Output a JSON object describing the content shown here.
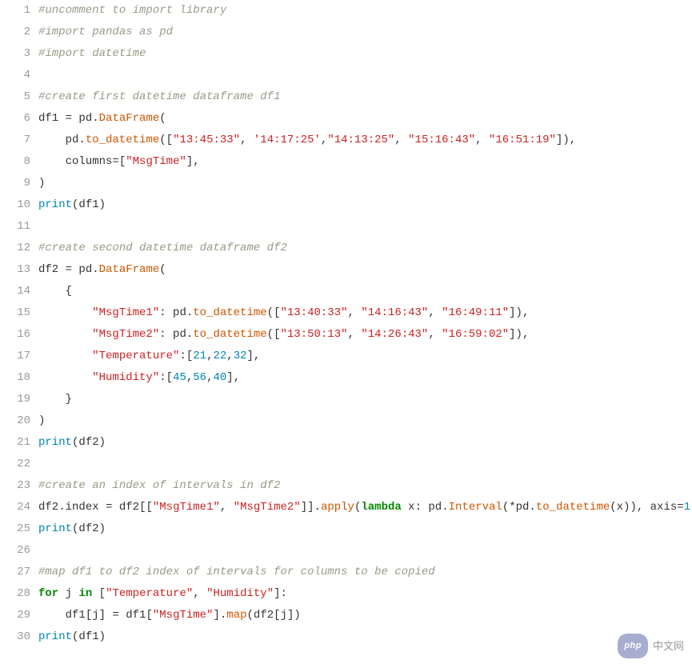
{
  "watermark": {
    "badge": "php",
    "text": "中文网"
  },
  "lines": [
    {
      "n": 1,
      "tokens": [
        [
          "c",
          "#uncomment to import library"
        ]
      ]
    },
    {
      "n": 2,
      "tokens": [
        [
          "c",
          "#import pandas as pd"
        ]
      ]
    },
    {
      "n": 3,
      "tokens": [
        [
          "c",
          "#import datetime"
        ]
      ]
    },
    {
      "n": 4,
      "tokens": []
    },
    {
      "n": 5,
      "tokens": [
        [
          "c",
          "#create first datetime dataframe df1"
        ]
      ]
    },
    {
      "n": 6,
      "tokens": [
        [
          "n",
          "df1 "
        ],
        [
          "o",
          "="
        ],
        [
          "n",
          " pd"
        ],
        [
          "p",
          "."
        ],
        [
          "nf",
          "DataFrame"
        ],
        [
          "p",
          "("
        ]
      ]
    },
    {
      "n": 7,
      "tokens": [
        [
          "n",
          "    pd"
        ],
        [
          "p",
          "."
        ],
        [
          "nf",
          "to_datetime"
        ],
        [
          "p",
          "(["
        ],
        [
          "s",
          "\"13:45:33\""
        ],
        [
          "p",
          ", "
        ],
        [
          "s",
          "'14:17:25'"
        ],
        [
          "p",
          ","
        ],
        [
          "s",
          "\"14:13:25\""
        ],
        [
          "p",
          ", "
        ],
        [
          "s",
          "\"15:16:43\""
        ],
        [
          "p",
          ", "
        ],
        [
          "s",
          "\"16:51:19\""
        ],
        [
          "p",
          "]),"
        ]
      ]
    },
    {
      "n": 8,
      "tokens": [
        [
          "n",
          "    columns"
        ],
        [
          "o",
          "="
        ],
        [
          "p",
          "["
        ],
        [
          "s",
          "\"MsgTime\""
        ],
        [
          "p",
          "],"
        ]
      ]
    },
    {
      "n": 9,
      "tokens": [
        [
          "p",
          ")"
        ]
      ]
    },
    {
      "n": 10,
      "tokens": [
        [
          "nn",
          "print"
        ],
        [
          "p",
          "("
        ],
        [
          "n",
          "df1"
        ],
        [
          "p",
          ")"
        ]
      ]
    },
    {
      "n": 11,
      "tokens": []
    },
    {
      "n": 12,
      "tokens": [
        [
          "c",
          "#create second datetime dataframe df2"
        ]
      ]
    },
    {
      "n": 13,
      "tokens": [
        [
          "n",
          "df2 "
        ],
        [
          "o",
          "="
        ],
        [
          "n",
          " pd"
        ],
        [
          "p",
          "."
        ],
        [
          "nf",
          "DataFrame"
        ],
        [
          "p",
          "("
        ]
      ]
    },
    {
      "n": 14,
      "tokens": [
        [
          "p",
          "    {"
        ]
      ]
    },
    {
      "n": 15,
      "tokens": [
        [
          "n",
          "        "
        ],
        [
          "s",
          "\"MsgTime1\""
        ],
        [
          "p",
          ": pd."
        ],
        [
          "nf",
          "to_datetime"
        ],
        [
          "p",
          "(["
        ],
        [
          "s",
          "\"13:40:33\""
        ],
        [
          "p",
          ", "
        ],
        [
          "s",
          "\"14:16:43\""
        ],
        [
          "p",
          ", "
        ],
        [
          "s",
          "\"16:49:11\""
        ],
        [
          "p",
          "]),"
        ]
      ]
    },
    {
      "n": 16,
      "tokens": [
        [
          "n",
          "        "
        ],
        [
          "s",
          "\"MsgTime2\""
        ],
        [
          "p",
          ": pd."
        ],
        [
          "nf",
          "to_datetime"
        ],
        [
          "p",
          "(["
        ],
        [
          "s",
          "\"13:50:13\""
        ],
        [
          "p",
          ", "
        ],
        [
          "s",
          "\"14:26:43\""
        ],
        [
          "p",
          ", "
        ],
        [
          "s",
          "\"16:59:02\""
        ],
        [
          "p",
          "]),"
        ]
      ]
    },
    {
      "n": 17,
      "tokens": [
        [
          "n",
          "        "
        ],
        [
          "s",
          "\"Temperature\""
        ],
        [
          "p",
          ":["
        ],
        [
          "mi",
          "21"
        ],
        [
          "p",
          ","
        ],
        [
          "mi",
          "22"
        ],
        [
          "p",
          ","
        ],
        [
          "mi",
          "32"
        ],
        [
          "p",
          "],"
        ]
      ]
    },
    {
      "n": 18,
      "tokens": [
        [
          "n",
          "        "
        ],
        [
          "s",
          "\"Humidity\""
        ],
        [
          "p",
          ":["
        ],
        [
          "mi",
          "45"
        ],
        [
          "p",
          ","
        ],
        [
          "mi",
          "56"
        ],
        [
          "p",
          ","
        ],
        [
          "mi",
          "40"
        ],
        [
          "p",
          "],"
        ]
      ]
    },
    {
      "n": 19,
      "tokens": [
        [
          "p",
          "    }"
        ]
      ]
    },
    {
      "n": 20,
      "tokens": [
        [
          "p",
          ")"
        ]
      ]
    },
    {
      "n": 21,
      "tokens": [
        [
          "nn",
          "print"
        ],
        [
          "p",
          "("
        ],
        [
          "n",
          "df2"
        ],
        [
          "p",
          ")"
        ]
      ]
    },
    {
      "n": 22,
      "tokens": []
    },
    {
      "n": 23,
      "tokens": [
        [
          "c",
          "#create an index of intervals in df2"
        ]
      ]
    },
    {
      "n": 24,
      "tokens": [
        [
          "n",
          "df2"
        ],
        [
          "p",
          "."
        ],
        [
          "n",
          "index "
        ],
        [
          "o",
          "="
        ],
        [
          "n",
          " df2"
        ],
        [
          "p",
          "[["
        ],
        [
          "s",
          "\"MsgTime1\""
        ],
        [
          "p",
          ", "
        ],
        [
          "s",
          "\"MsgTime2\""
        ],
        [
          "p",
          "]]."
        ],
        [
          "nf",
          "apply"
        ],
        [
          "p",
          "("
        ],
        [
          "k",
          "lambda"
        ],
        [
          "n",
          " x"
        ],
        [
          "p",
          ": pd."
        ],
        [
          "nf",
          "Interval"
        ],
        [
          "p",
          "(*pd."
        ],
        [
          "nf",
          "to_datetime"
        ],
        [
          "p",
          "(x)), axis"
        ],
        [
          "o",
          "="
        ],
        [
          "mi",
          "1"
        ],
        [
          "p",
          ")"
        ]
      ]
    },
    {
      "n": 25,
      "tokens": [
        [
          "nn",
          "print"
        ],
        [
          "p",
          "("
        ],
        [
          "n",
          "df2"
        ],
        [
          "p",
          ")"
        ]
      ]
    },
    {
      "n": 26,
      "tokens": []
    },
    {
      "n": 27,
      "tokens": [
        [
          "c",
          "#map df1 to df2 index of intervals for columns to be copied"
        ]
      ]
    },
    {
      "n": 28,
      "tokens": [
        [
          "k",
          "for"
        ],
        [
          "n",
          " j "
        ],
        [
          "k",
          "in"
        ],
        [
          "p",
          " ["
        ],
        [
          "s",
          "\"Temperature\""
        ],
        [
          "p",
          ", "
        ],
        [
          "s",
          "\"Humidity\""
        ],
        [
          "p",
          "]:"
        ]
      ]
    },
    {
      "n": 29,
      "tokens": [
        [
          "n",
          "    df1"
        ],
        [
          "p",
          "["
        ],
        [
          "n",
          "j"
        ],
        [
          "p",
          "] "
        ],
        [
          "o",
          "="
        ],
        [
          "n",
          " df1"
        ],
        [
          "p",
          "["
        ],
        [
          "s",
          "\"MsgTime\""
        ],
        [
          "p",
          "]."
        ],
        [
          "nf",
          "map"
        ],
        [
          "p",
          "("
        ],
        [
          "n",
          "df2"
        ],
        [
          "p",
          "["
        ],
        [
          "n",
          "j"
        ],
        [
          "p",
          "])"
        ]
      ]
    },
    {
      "n": 30,
      "tokens": [
        [
          "nn",
          "print"
        ],
        [
          "p",
          "("
        ],
        [
          "n",
          "df1"
        ],
        [
          "p",
          ")"
        ]
      ]
    }
  ]
}
